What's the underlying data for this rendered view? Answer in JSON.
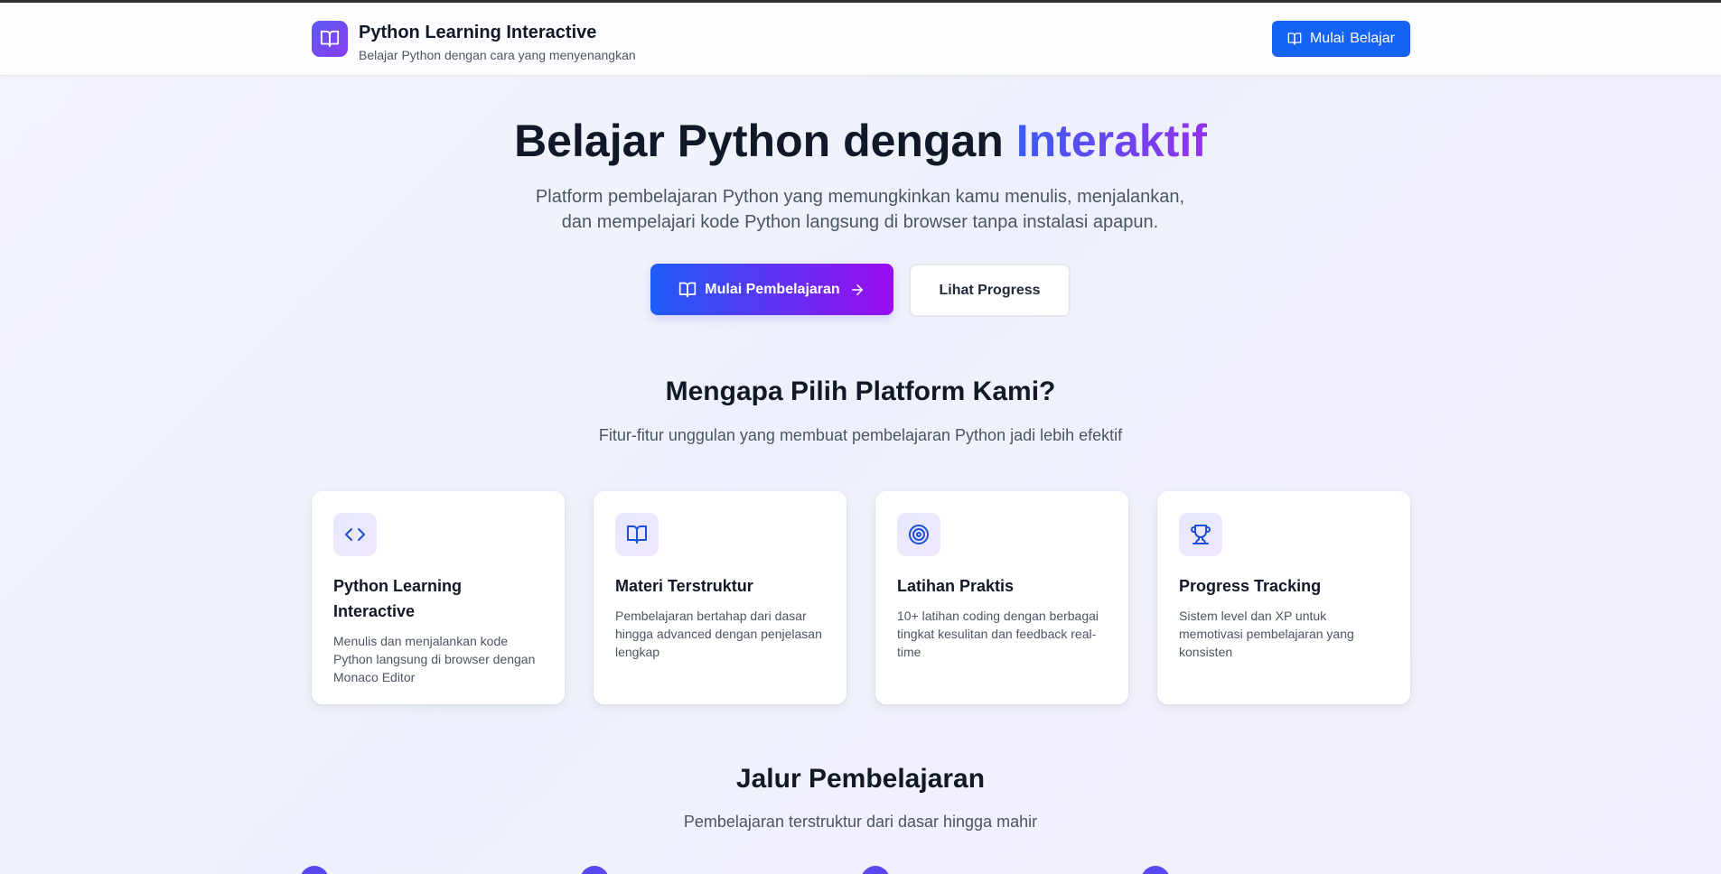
{
  "colors": {
    "accent": "#1463f3",
    "gradient_start": "#3b5bf6",
    "gradient_end": "#9333ea",
    "text_dark": "#111827",
    "text_muted": "#4b5563"
  },
  "header": {
    "logo_icon": "book-open-icon",
    "title": "Python Learning Interactive",
    "subtitle": "Belajar Python dengan cara yang menyenangkan",
    "cta_icon": "book-open-icon",
    "cta_word1": "Mulai",
    "cta_word2": "Belajar"
  },
  "hero": {
    "title_plain": "Belajar Python dengan ",
    "title_highlight": "Interaktif",
    "description_line1": "Platform pembelajaran Python yang memungkinkan kamu menulis, menjalankan,",
    "description_line2": "dan mempelajari kode Python langsung di browser tanpa instalasi apapun.",
    "primary_button": "Mulai Pembelajaran",
    "primary_icon": "book-open-icon",
    "primary_arrow": "arrow-right-icon",
    "secondary_button": "Lihat Progress"
  },
  "features": {
    "title": "Mengapa Pilih Platform Kami?",
    "subtitle": "Fitur-fitur unggulan yang membuat pembelajaran Python jadi lebih efektif",
    "cards": [
      {
        "icon": "code-icon",
        "title": "Python Learning Interactive",
        "description": "Menulis dan menjalankan kode Python langsung di browser dengan Monaco Editor"
      },
      {
        "icon": "book-open-icon",
        "title": "Materi Terstruktur",
        "description": "Pembelajaran bertahap dari dasar hingga advanced dengan penjelasan lengkap"
      },
      {
        "icon": "target-icon",
        "title": "Latihan Praktis",
        "description": "10+ latihan coding dengan berbagai tingkat kesulitan dan feedback real-time"
      },
      {
        "icon": "trophy-icon",
        "title": "Progress Tracking",
        "description": "Sistem level dan XP untuk memotivasi pembelajaran yang konsisten"
      }
    ]
  },
  "learning_path": {
    "title": "Jalur Pembelajaran",
    "subtitle": "Pembelajaran terstruktur dari dasar hingga mahir"
  }
}
